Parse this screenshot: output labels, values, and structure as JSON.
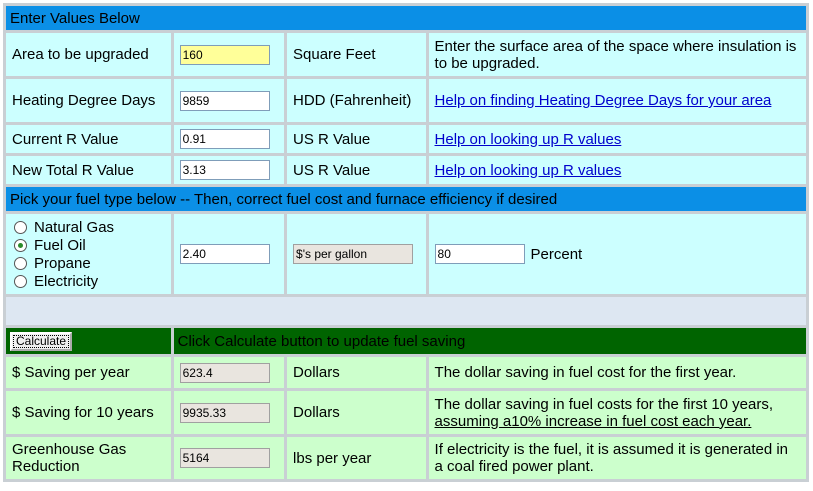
{
  "sections": {
    "enter_values": "Enter Values Below",
    "fuel_pick": "Pick your fuel type below -- Then, correct fuel cost and furnace efficiency if desired",
    "calc_hint": "Click Calculate button to update fuel saving"
  },
  "inputs": [
    {
      "label": "Area to be upgraded",
      "value": "160",
      "unit": "Square Feet",
      "note": "Enter the surface area of the space where insulation is to be upgraded."
    },
    {
      "label": "Heating Degree Days",
      "value": "9859",
      "unit": "HDD (Fahrenheit)",
      "link": "Help on finding Heating Degree Days for your area"
    },
    {
      "label": "Current R Value",
      "value": "0.91",
      "unit": "US R Value",
      "link": "Help on looking up R values"
    },
    {
      "label": "New Total R Value",
      "value": "3.13",
      "unit": "US R Value",
      "link": "Help on looking up R values"
    }
  ],
  "fuel": {
    "options": [
      "Natural Gas",
      "Fuel Oil",
      "Propane",
      "Electricity"
    ],
    "selected": "Fuel Oil",
    "cost": "2.40",
    "cost_unit": "$'s per gallon",
    "efficiency": "80",
    "efficiency_unit": "Percent"
  },
  "calculate_label": "Calculate",
  "results": [
    {
      "label": "$ Saving per year",
      "value": "623.4",
      "unit": "Dollars",
      "note": "The dollar saving in fuel cost for the first year."
    },
    {
      "label": "$ Saving for 10 years",
      "value": "9935.33",
      "unit": "Dollars",
      "note_line1": "The dollar saving in fuel costs for the first 10 years,",
      "note_line2": "assuming a10% increase in fuel cost each year."
    },
    {
      "label": "Greenhouse Gas Reduction",
      "value": "5164",
      "unit": "lbs per year",
      "note": "If electricity is the fuel, it is assumed it is generated in a coal fired power plant."
    }
  ],
  "colors": {
    "section_bar": "#0b8fe6",
    "input_bg": "#ccffff",
    "result_bg": "#ccffcc",
    "dark_bar": "#006400"
  }
}
